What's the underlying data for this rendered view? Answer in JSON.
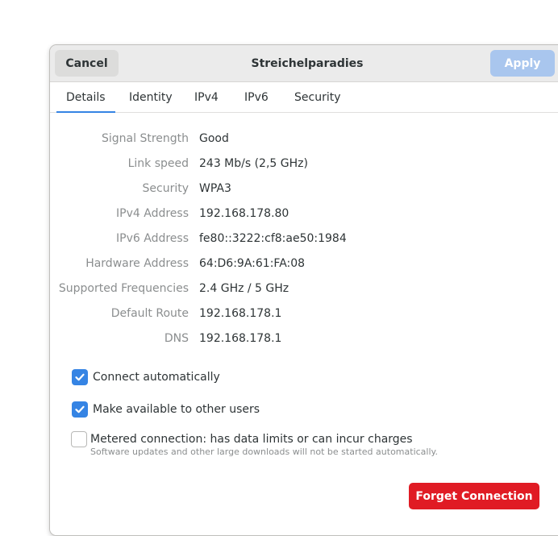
{
  "header": {
    "cancel_label": "Cancel",
    "title": "Streichelparadies",
    "apply_label": "Apply"
  },
  "tabs": [
    {
      "label": "Details",
      "active": true
    },
    {
      "label": "Identity",
      "active": false
    },
    {
      "label": "IPv4",
      "active": false
    },
    {
      "label": "IPv6",
      "active": false
    },
    {
      "label": "Security",
      "active": false
    }
  ],
  "details": [
    {
      "label": "Signal Strength",
      "value": "Good"
    },
    {
      "label": "Link speed",
      "value": "243 Mb/s (2,5 GHz)"
    },
    {
      "label": "Security",
      "value": "WPA3"
    },
    {
      "label": "IPv4 Address",
      "value": "192.168.178.80"
    },
    {
      "label": "IPv6 Address",
      "value": "fe80::3222:cf8:ae50:1984"
    },
    {
      "label": "Hardware Address",
      "value": "64:D6:9A:61:FA:08"
    },
    {
      "label": "Supported Frequencies",
      "value": "2.4 GHz / 5 GHz"
    },
    {
      "label": "Default Route",
      "value": "192.168.178.1"
    },
    {
      "label": "DNS",
      "value": "192.168.178.1"
    }
  ],
  "options": {
    "connect_automatically": {
      "label": "Connect automatically",
      "checked": true
    },
    "available_to_others": {
      "label": "Make available to other users",
      "checked": true
    },
    "metered": {
      "label": "Metered connection: has data limits or can incur charges",
      "sublabel": "Software updates and other large downloads will not be started automatically.",
      "checked": false
    }
  },
  "forget_label": "Forget Connection",
  "colors": {
    "accent": "#3584e4",
    "destructive": "#e01b24",
    "apply_disabled": "#a9c6ee"
  },
  "icons": {
    "checkmark": "check-icon"
  }
}
